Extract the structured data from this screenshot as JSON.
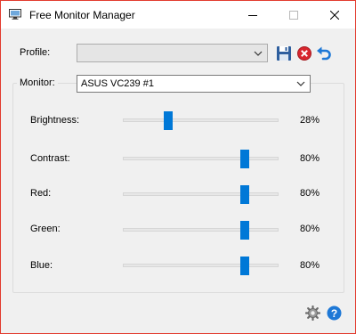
{
  "window": {
    "title": "Free Monitor Manager",
    "controls": {
      "minimize": "minimize-icon",
      "maximize": "maximize-icon",
      "close": "close-icon"
    }
  },
  "profile": {
    "label": "Profile:",
    "value": "",
    "buttons": [
      {
        "name": "save-profile",
        "icon": "floppy-disk-icon"
      },
      {
        "name": "delete-profile",
        "icon": "red-x-circle-icon"
      },
      {
        "name": "undo",
        "icon": "undo-arrow-icon"
      }
    ]
  },
  "monitor": {
    "label": "Monitor:",
    "value": "ASUS VC239 #1"
  },
  "sliders": [
    {
      "id": "brightness",
      "label": "Brightness:",
      "value": 28,
      "display": "28%"
    },
    {
      "id": "contrast",
      "label": "Contrast:",
      "value": 80,
      "display": "80%"
    },
    {
      "id": "red",
      "label": "Red:",
      "value": 80,
      "display": "80%"
    },
    {
      "id": "green",
      "label": "Green:",
      "value": 80,
      "display": "80%"
    },
    {
      "id": "blue",
      "label": "Blue:",
      "value": 80,
      "display": "80%"
    }
  ],
  "footer": {
    "settings_icon": "gear-icon",
    "help_icon": "help-icon"
  },
  "colors": {
    "accent": "#0078d7",
    "window_border": "#e23b2e",
    "background": "#f0f0f0"
  }
}
